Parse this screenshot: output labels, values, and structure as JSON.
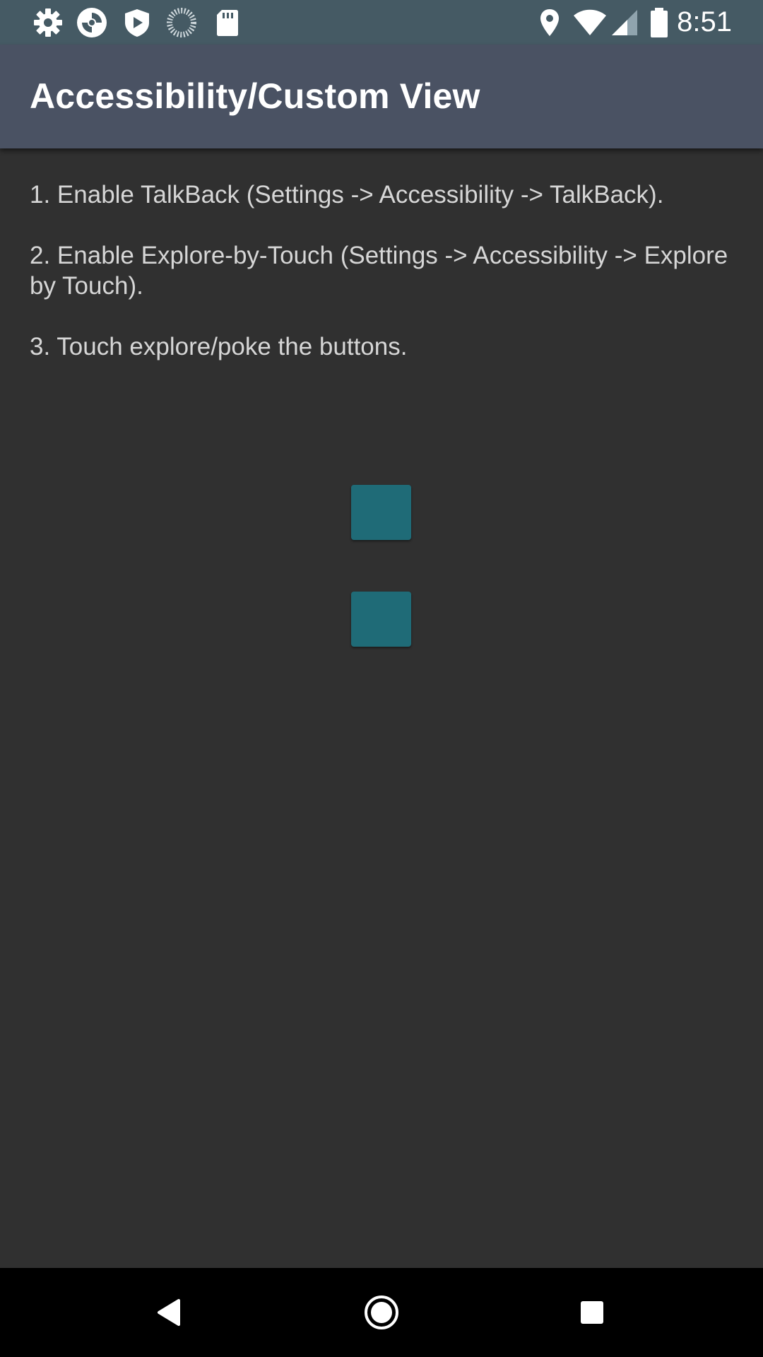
{
  "status_bar": {
    "time": "8:51",
    "left_icons": [
      "settings-icon",
      "shutter-icon",
      "shield-play-icon",
      "sync-progress-icon",
      "sd-card-icon"
    ],
    "right_icons": [
      "location-icon",
      "wifi-icon",
      "signal-icon",
      "battery-icon"
    ]
  },
  "app_bar": {
    "title": "Accessibility/Custom View"
  },
  "instructions": {
    "step1": "1. Enable TalkBack (Settings -> Accessibility -> TalkBack).",
    "step2": "2. Enable Explore-by-Touch (Settings -> Accessibility -> Explore by Touch).",
    "step3": "3. Touch explore/poke the buttons."
  },
  "custom_view": {
    "button_color": "#1f6b77",
    "button_count": 2
  },
  "nav_bar": {
    "buttons": [
      "back-icon",
      "home-icon",
      "recents-icon"
    ]
  },
  "colors": {
    "status_bar": "#455a64",
    "app_bar": "#4a5263",
    "background": "#303030",
    "text": "#d6d6d6"
  }
}
